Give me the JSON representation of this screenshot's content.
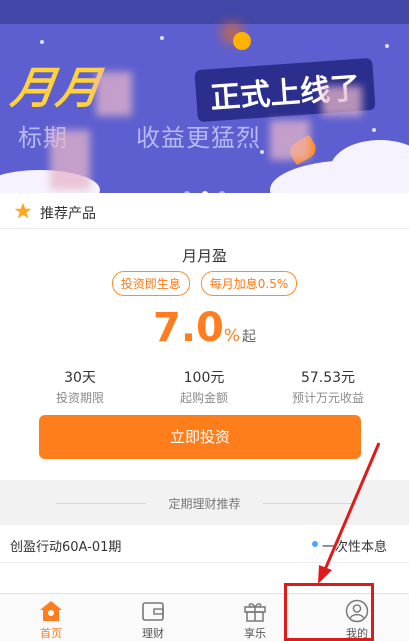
{
  "banner": {
    "headline": "月月",
    "headline_tail": "正式上线了",
    "subtitle_left": "标期",
    "subtitle_right": "收益更猛烈"
  },
  "recommended": {
    "label": "推荐产品"
  },
  "product": {
    "name": "月月盈",
    "tags": [
      "投资即生息",
      "每月加息0.5%"
    ],
    "rate_value": "7.0",
    "rate_unit": "%",
    "rate_suffix": "起",
    "stats": [
      {
        "value": "30天",
        "label": "投资期限"
      },
      {
        "value": "100元",
        "label": "起购金额"
      },
      {
        "value": "57.53元",
        "label": "预计万元收益"
      }
    ],
    "invest_button": "立即投资"
  },
  "section_title": "定期理财推荐",
  "list_item": {
    "name": "创盈行动60A-01期",
    "repayment": "一次性本息"
  },
  "tabbar": {
    "items": [
      {
        "label": "首页",
        "icon": "home-icon",
        "active": true
      },
      {
        "label": "理财",
        "icon": "wallet-icon",
        "active": false
      },
      {
        "label": "享乐",
        "icon": "gift-icon",
        "active": false
      },
      {
        "label": "我的",
        "icon": "user-icon",
        "active": false
      }
    ]
  },
  "colors": {
    "accent": "#ff7e1c",
    "banner_bg": "#5d5fd0",
    "annotation": "#e01a1a"
  }
}
